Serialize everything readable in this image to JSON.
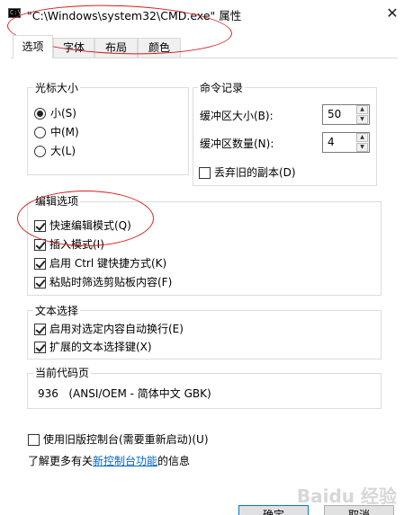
{
  "window": {
    "title": "\"C:\\Windows\\system32\\CMD.exe\" 属性",
    "close_glyph": "✕",
    "icon_label": "C:\\"
  },
  "tabs": [
    {
      "label": "选项",
      "active": true
    },
    {
      "label": "字体",
      "active": false
    },
    {
      "label": "布局",
      "active": false
    },
    {
      "label": "颜色",
      "active": false
    }
  ],
  "cursor_size": {
    "title": "光标大小",
    "options": [
      {
        "label": "小(S)",
        "selected": true
      },
      {
        "label": "中(M)",
        "selected": false
      },
      {
        "label": "大(L)",
        "selected": false
      }
    ]
  },
  "command_history": {
    "title": "命令记录",
    "buffer_size_label": "缓冲区大小(B):",
    "buffer_size_value": "50",
    "buffer_count_label": "缓冲区数量(N):",
    "buffer_count_value": "4",
    "discard_label": "丢弃旧的副本(D)",
    "discard_checked": false
  },
  "edit_options": {
    "title": "编辑选项",
    "items": [
      {
        "label": "快速编辑模式(Q)",
        "checked": true
      },
      {
        "label": "插入模式(I)",
        "checked": true
      },
      {
        "label": "启用 Ctrl 键快捷方式(K)",
        "checked": true
      },
      {
        "label": "粘贴时筛选剪贴板内容(F)",
        "checked": true
      }
    ]
  },
  "text_selection": {
    "title": "文本选择",
    "items": [
      {
        "label": "启用对选定内容自动换行(E)",
        "checked": true
      },
      {
        "label": "扩展的文本选择键(X)",
        "checked": true
      }
    ]
  },
  "code_page": {
    "title": "当前代码页",
    "value": "936   (ANSI/OEM - 简体中文 GBK)"
  },
  "legacy_console": {
    "label": "使用旧版控制台(需要重新启动)(U)",
    "checked": false
  },
  "learn_more": {
    "prefix": "了解更多有关",
    "link": "新控制台功能",
    "suffix": "的信息"
  },
  "buttons": {
    "ok": "确定",
    "cancel": "取消"
  },
  "watermark": "Baidu 经验",
  "colors": {
    "annotation": "#d42020",
    "link": "#0066cc",
    "default_button_border": "#0078d7"
  }
}
